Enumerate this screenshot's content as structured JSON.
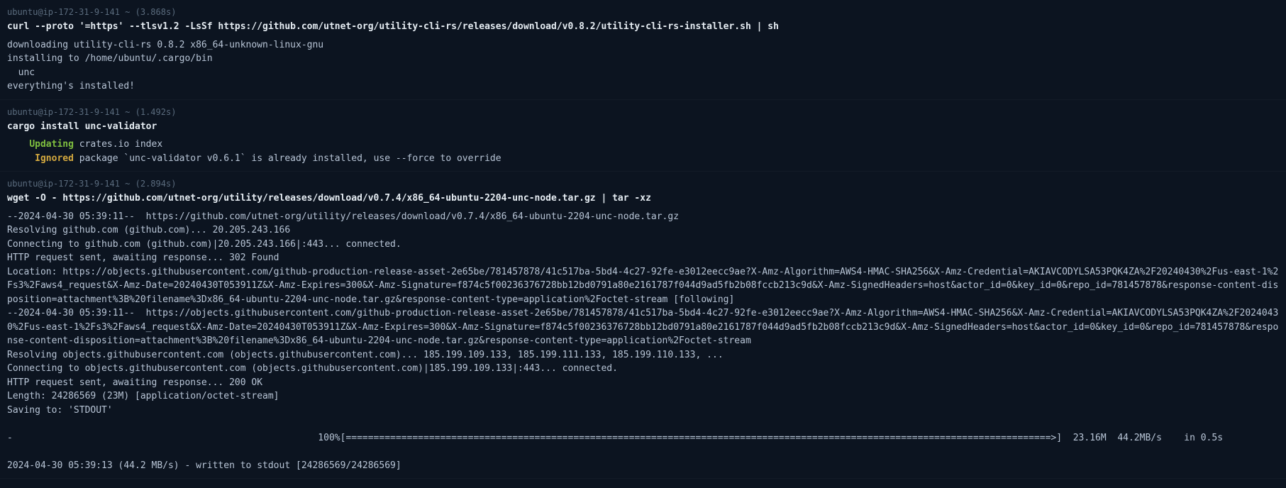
{
  "block1": {
    "prompt": "ubuntu@ip-172-31-9-141 ~ (3.868s)",
    "command": "curl --proto '=https' --tlsv1.2 -LsSf https://github.com/utnet-org/utility-cli-rs/releases/download/v0.8.2/utility-cli-rs-installer.sh | sh",
    "output": "downloading utility-cli-rs 0.8.2 x86_64-unknown-linux-gnu\ninstalling to /home/ubuntu/.cargo/bin\n  unc\neverything's installed!"
  },
  "block2": {
    "prompt": "ubuntu@ip-172-31-9-141 ~ (1.492s)",
    "command": "cargo install unc-validator",
    "line1_indent": "    ",
    "line1_status": "Updating",
    "line1_text": " crates.io index",
    "line2_indent": "     ",
    "line2_status": "Ignored",
    "line2_text": " package `unc-validator v0.6.1` is already installed, use --force to override"
  },
  "block3": {
    "prompt": "ubuntu@ip-172-31-9-141 ~ (2.894s)",
    "command": "wget -O - https://github.com/utnet-org/utility/releases/download/v0.7.4/x86_64-ubuntu-2204-unc-node.tar.gz | tar -xz",
    "output_part1": "--2024-04-30 05:39:11--  https://github.com/utnet-org/utility/releases/download/v0.7.4/x86_64-ubuntu-2204-unc-node.tar.gz\nResolving github.com (github.com)... 20.205.243.166\nConnecting to github.com (github.com)|20.205.243.166|:443... connected.\nHTTP request sent, awaiting response... 302 Found\nLocation: https://objects.githubusercontent.com/github-production-release-asset-2e65be/781457878/41c517ba-5bd4-4c27-92fe-e3012eecc9ae?X-Amz-Algorithm=AWS4-HMAC-SHA256&X-Amz-Credential=AKIAVCODYLSA53PQK4ZA%2F20240430%2Fus-east-1%2Fs3%2Faws4_request&X-Amz-Date=20240430T053911Z&X-Amz-Expires=300&X-Amz-Signature=f874c5f00236376728bb12bd0791a80e2161787f044d9ad5fb2b08fccb213c9d&X-Amz-SignedHeaders=host&actor_id=0&key_id=0&repo_id=781457878&response-content-disposition=attachment%3B%20filename%3Dx86_64-ubuntu-2204-unc-node.tar.gz&response-content-type=application%2Foctet-stream [following]\n--2024-04-30 05:39:11--  https://objects.githubusercontent.com/github-production-release-asset-2e65be/781457878/41c517ba-5bd4-4c27-92fe-e3012eecc9ae?X-Amz-Algorithm=AWS4-HMAC-SHA256&X-Amz-Credential=AKIAVCODYLSA53PQK4ZA%2F20240430%2Fus-east-1%2Fs3%2Faws4_request&X-Amz-Date=20240430T053911Z&X-Amz-Expires=300&X-Amz-Signature=f874c5f00236376728bb12bd0791a80e2161787f044d9ad5fb2b08fccb213c9d&X-Amz-SignedHeaders=host&actor_id=0&key_id=0&repo_id=781457878&response-content-disposition=attachment%3B%20filename%3Dx86_64-ubuntu-2204-unc-node.tar.gz&response-content-type=application%2Foctet-stream\nResolving objects.githubusercontent.com (objects.githubusercontent.com)... 185.199.109.133, 185.199.111.133, 185.199.110.133, ...\nConnecting to objects.githubusercontent.com (objects.githubusercontent.com)|185.199.109.133|:443... connected.\nHTTP request sent, awaiting response... 200 OK\nLength: 24286569 (23M) [application/octet-stream]\nSaving to: 'STDOUT'\n\n-                                                       100%[===============================================================================================================================>]  23.16M  44.2MB/s    in 0.5s\n\n2024-04-30 05:39:13 (44.2 MB/s) - written to stdout [24286569/24286569]"
  }
}
